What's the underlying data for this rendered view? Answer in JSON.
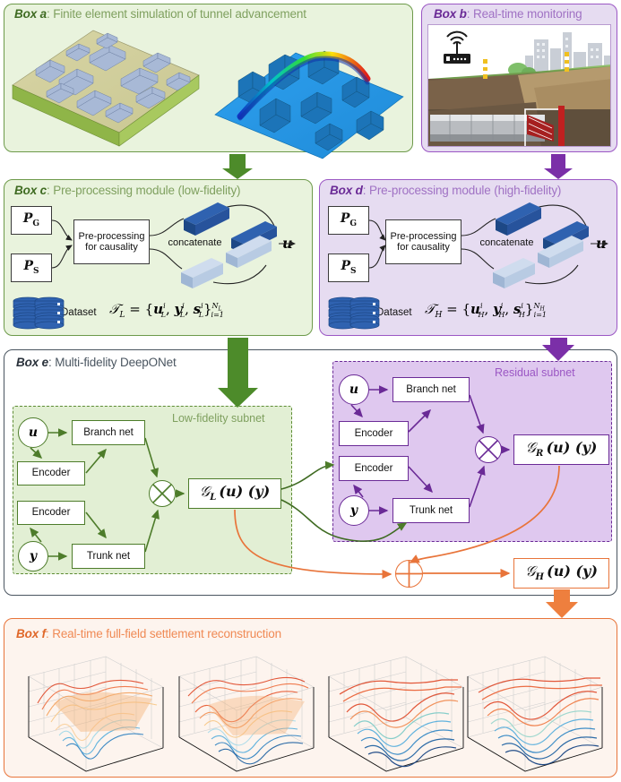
{
  "boxes": {
    "a": {
      "tag": "Box a",
      "sep": ": ",
      "title": "Finite element simulation of tunnel advancement",
      "color": "#6d9a4a"
    },
    "b": {
      "tag": "Box b",
      "sep": ": ",
      "title": "Real-time monitoring",
      "color": "#9b57c4"
    },
    "c": {
      "tag": "Box c",
      "sep": ": ",
      "title": "Pre-processing module (low-fidelity)",
      "color": "#6d9a4a"
    },
    "d": {
      "tag": "Box d",
      "sep": ": ",
      "title": "Pre-processing module (high-fidelity)",
      "color": "#9b57c4"
    },
    "e": {
      "tag": "Box e",
      "sep": ": ",
      "title": "Multi-fidelity DeepONet",
      "color": "#4a5560"
    },
    "f": {
      "tag": "Box f",
      "sep": ": ",
      "title": "Real-time full-field settlement reconstruction",
      "color": "#e8743a"
    }
  },
  "preprocessing_low": {
    "input_g": "P",
    "input_g_sub": "G",
    "input_s": "P",
    "input_s_sub": "S",
    "process": "Pre-processing for causality",
    "concatenate": "concatenate",
    "output": "u",
    "dataset_label": "Dataset",
    "dataset_symbol": "𝒯",
    "dataset_symbol_sub": "L",
    "dataset_eq": "=",
    "dataset_set": "{ uᵢᴸ, yᵢᴸ, sᵢᴸ }",
    "dataset_terms": [
      "u",
      "y",
      "s"
    ],
    "dataset_fidelity": "L",
    "dataset_sup": "i",
    "dataset_count": "N",
    "dataset_count_sub": "L",
    "dataset_index": "i = 1"
  },
  "preprocessing_high": {
    "input_g": "P",
    "input_g_sub": "G",
    "input_s": "P",
    "input_s_sub": "S",
    "process": "Pre-processing for causality",
    "concatenate": "concatenate",
    "output": "u",
    "dataset_label": "Dataset",
    "dataset_symbol": "𝒯",
    "dataset_symbol_sub": "H",
    "dataset_eq": "=",
    "dataset_terms": [
      "u",
      "y",
      "s"
    ],
    "dataset_fidelity": "H",
    "dataset_sup": "i",
    "dataset_count": "N",
    "dataset_count_sub": "H",
    "dataset_index": "i = 1"
  },
  "deeponet": {
    "low_subnet_label": "Low-fidelity subnet",
    "residual_subnet_label": "Residual subnet",
    "low": {
      "input_u": "u",
      "input_y": "y",
      "branch": "Branch net",
      "trunk": "Trunk net",
      "encoder_top": "Encoder",
      "encoder_bottom": "Encoder",
      "operator": "×",
      "output_symbol": "𝒢",
      "output_sub": "L",
      "output_args": "(u) (y)"
    },
    "residual": {
      "input_u": "u",
      "input_y": "y",
      "branch": "Branch net",
      "trunk": "Trunk net",
      "encoder_top": "Encoder",
      "encoder_bottom": "Encoder",
      "operator": "×",
      "output_symbol": "𝒢",
      "output_sub": "R",
      "output_args": "(u) (y)"
    },
    "sum_operator": "+",
    "final": {
      "output_symbol": "𝒢",
      "output_sub": "H",
      "output_args": "(u) (y)"
    }
  },
  "colors": {
    "green_border": "#6d9a4a",
    "green_fill": "#e9f3dd",
    "green_dark": "#3f6b22",
    "green_arrow": "#4d8b2a",
    "purple_border": "#9b57c4",
    "purple_fill": "#e6dcf1",
    "purple_dark": "#6a2a96",
    "purple_arrow": "#7b2fa8",
    "orange": "#e8743a",
    "slate": "#4a5560"
  },
  "box_f": {
    "plot_count": 4,
    "description": "Four 3D surface plots of settlement field at successive tunnel advancement stages"
  }
}
